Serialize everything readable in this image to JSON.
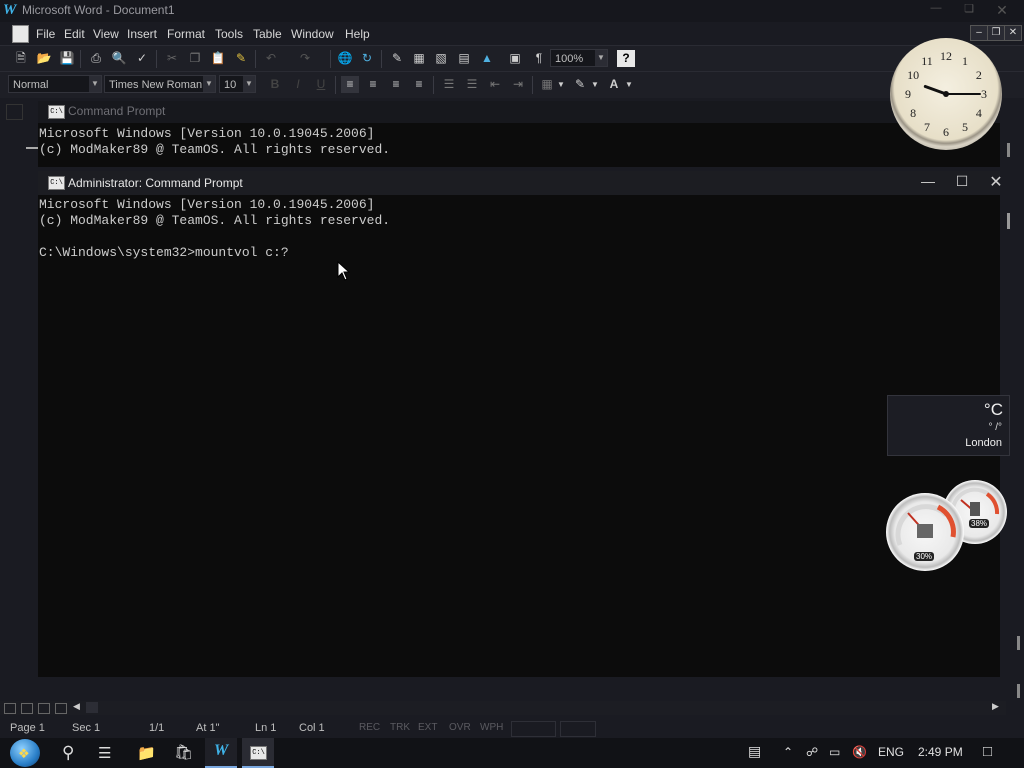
{
  "word": {
    "title": "Microsoft Word - Document1",
    "logo": "W",
    "menu": [
      "File",
      "Edit",
      "View",
      "Insert",
      "Format",
      "Tools",
      "Table",
      "Window",
      "Help"
    ],
    "formatting": {
      "style": "Normal",
      "font": "Times New Roman",
      "size": "10",
      "zoom": "100%"
    },
    "status": {
      "page": "Page  1",
      "sec": "Sec  1",
      "pages": "1/1",
      "at": "At  1\"",
      "ln": "Ln  1",
      "col": "Col  1",
      "rec": "REC",
      "trk": "TRK",
      "ext": "EXT",
      "ovr": "OVR",
      "wph": "WPH"
    }
  },
  "cmd_back": {
    "title": "Command Prompt",
    "lines": [
      "Microsoft Windows [Version 10.0.19045.2006]",
      "(c) ModMaker89 @ TeamOS. All rights reserved."
    ]
  },
  "cmd_front": {
    "title": "Administrator: Command Prompt",
    "lines": [
      "Microsoft Windows [Version 10.0.19045.2006]",
      "(c) ModMaker89 @ TeamOS. All rights reserved.",
      "",
      "C:\\Windows\\system32>mountvol c:?"
    ]
  },
  "clock": {
    "numbers": [
      "12",
      "1",
      "2",
      "3",
      "4",
      "5",
      "6",
      "7",
      "8",
      "9",
      "10",
      "11"
    ],
    "hour_hand_deg": 290,
    "minute_hand_deg": 90
  },
  "weather": {
    "unit": "°C",
    "range": "° /°",
    "city": "London"
  },
  "meters": {
    "cpu": "30%",
    "memory": "38%"
  },
  "taskbar": {
    "language": "ENG",
    "time": "2:49 PM"
  },
  "colors": {
    "console_bg": "#0c0c0c",
    "accent_word": "#3fb3e8",
    "highlight_yellow": "#f0e000",
    "font_red": "#e02020"
  }
}
